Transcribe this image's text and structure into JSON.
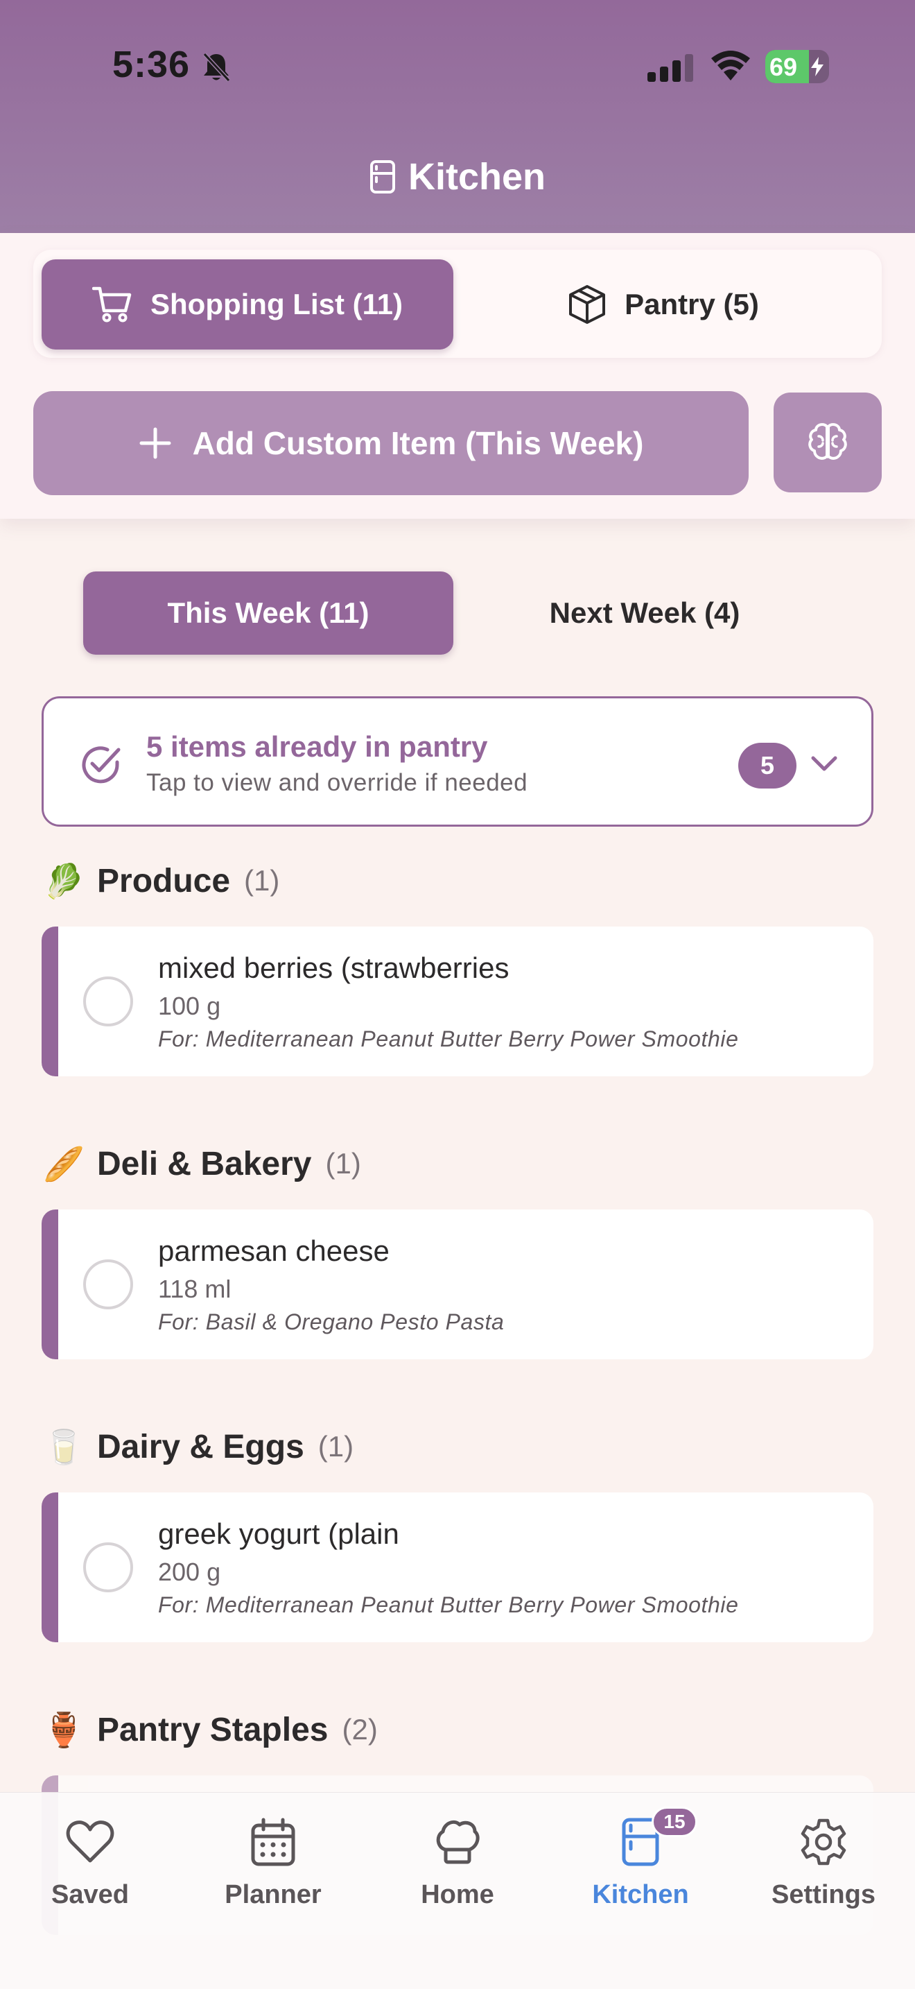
{
  "status_bar": {
    "time": "5:36",
    "battery": "69",
    "battery_level": 0.69
  },
  "header": {
    "title": "Kitchen"
  },
  "segment": {
    "shopping_label": "Shopping List (11)",
    "pantry_label": "Pantry (5)"
  },
  "actions": {
    "add_custom_label": "Add Custom Item (This Week)"
  },
  "week_tabs": {
    "this_week": "This Week (11)",
    "next_week": "Next Week (4)"
  },
  "pantry_banner": {
    "title": "5 items already in pantry",
    "subtitle": "Tap to view and override if needed",
    "badge": "5"
  },
  "categories": [
    {
      "emoji": "🥬",
      "name": "Produce",
      "count": "(1)",
      "items": [
        {
          "name": "mixed berries (strawberries",
          "qty": "100 g",
          "for": "For: Mediterranean Peanut Butter Berry Power Smoothie"
        }
      ]
    },
    {
      "emoji": "🥖",
      "name": "Deli & Bakery",
      "count": "(1)",
      "items": [
        {
          "name": "parmesan cheese",
          "qty": "118 ml",
          "for": "For: Basil & Oregano Pesto Pasta"
        }
      ]
    },
    {
      "emoji": "🥛",
      "name": "Dairy & Eggs",
      "count": "(1)",
      "items": [
        {
          "name": "greek yogurt (plain",
          "qty": "200 g",
          "for": "For: Mediterranean Peanut Butter Berry Power Smoothie"
        }
      ]
    },
    {
      "emoji": "🏺",
      "name": "Pantry Staples",
      "count": "(2)",
      "items": []
    }
  ],
  "tab_bar": {
    "saved": "Saved",
    "planner": "Planner",
    "home": "Home",
    "kitchen": "Kitchen",
    "kitchen_badge": "15",
    "settings": "Settings"
  },
  "colors": {
    "accent": "#94679a",
    "accent_light": "#b18fb5",
    "active_tab": "#4a86dc",
    "background": "#fbf2ef"
  },
  "icons": {
    "header": "fridge-icon",
    "shopping": "cart-icon",
    "pantry": "box-icon",
    "add": "plus-icon",
    "ai": "brain-icon",
    "banner": "check-circle-icon",
    "expand": "chevron-down-icon",
    "tabs": [
      "heart-icon",
      "calendar-icon",
      "chef-hat-icon",
      "fridge-icon",
      "gear-icon"
    ]
  }
}
